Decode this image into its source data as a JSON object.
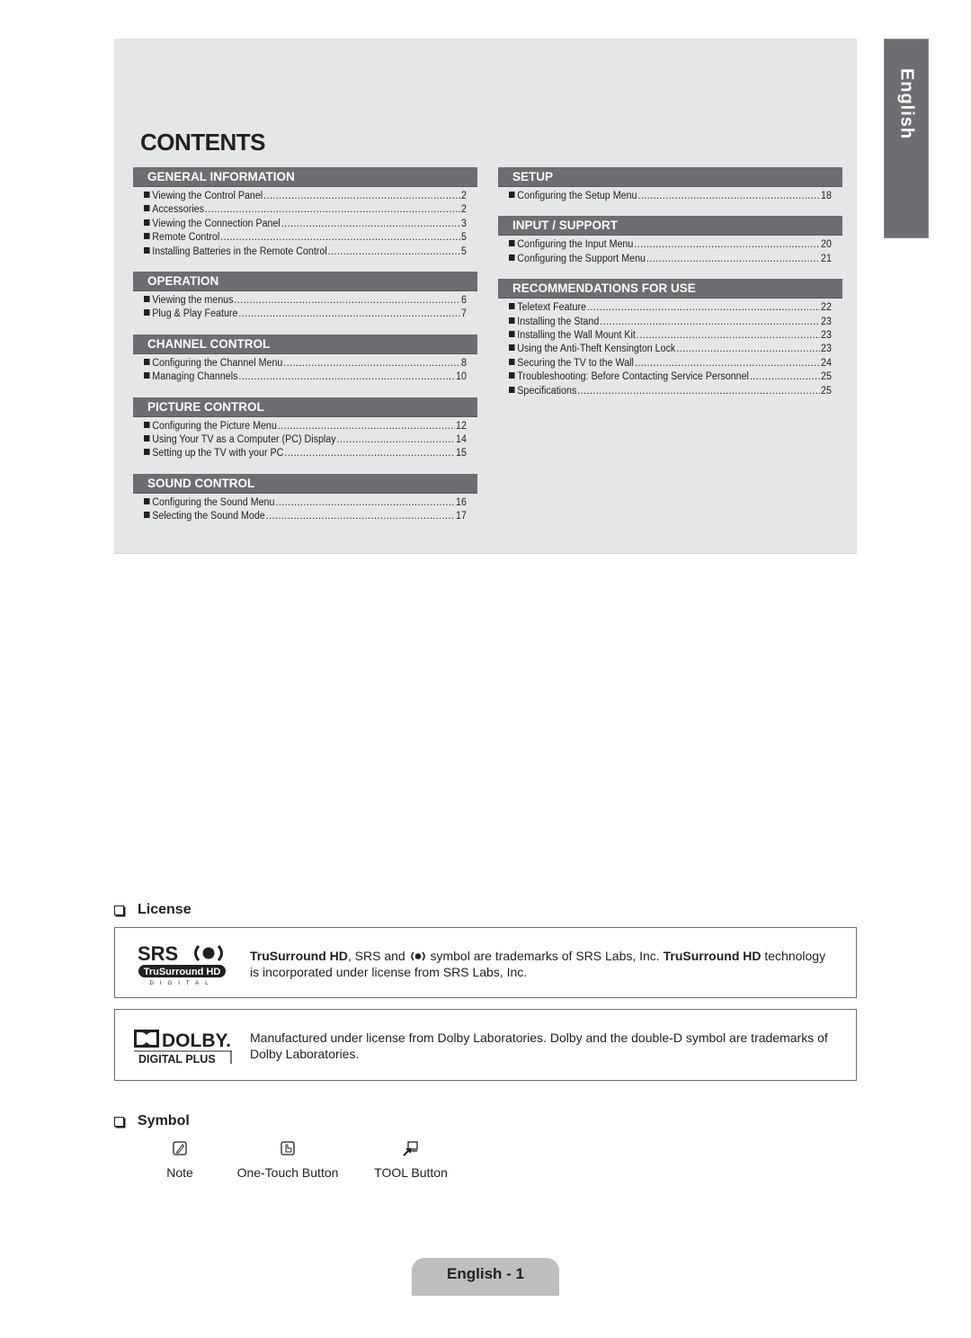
{
  "contents": {
    "title": "CONTENTS",
    "left_sections": [
      {
        "header": "GENERAL INFORMATION",
        "entries": [
          {
            "title": "Viewing the Control Panel",
            "page": "2"
          },
          {
            "title": "Accessories",
            "page": "2"
          },
          {
            "title": "Viewing the Connection Panel",
            "page": "3"
          },
          {
            "title": "Remote Control",
            "page": "5"
          },
          {
            "title": "Installing Batteries in the Remote Control",
            "page": "5"
          }
        ]
      },
      {
        "header": "OPERATION",
        "entries": [
          {
            "title": "Viewing the menus",
            "page": "6"
          },
          {
            "title": "Plug & Play Feature",
            "page": "7"
          }
        ]
      },
      {
        "header": "CHANNEL CONTROL",
        "entries": [
          {
            "title": "Configuring the Channel Menu",
            "page": "8"
          },
          {
            "title": "Managing Channels",
            "page": "10"
          }
        ]
      },
      {
        "header": "PICTURE CONTROL",
        "entries": [
          {
            "title": "Configuring the Picture Menu",
            "page": "12"
          },
          {
            "title": "Using Your TV as a Computer (PC) Display",
            "page": "14"
          },
          {
            "title": "Setting up the TV with your PC",
            "page": "15"
          }
        ]
      },
      {
        "header": "SOUND CONTROL",
        "entries": [
          {
            "title": "Configuring the Sound Menu",
            "page": "16"
          },
          {
            "title": "Selecting the Sound Mode",
            "page": "17"
          }
        ]
      }
    ],
    "right_sections": [
      {
        "header": "SETUP",
        "entries": [
          {
            "title": "Configuring the Setup Menu",
            "page": "18"
          }
        ]
      },
      {
        "header": "INPUT / SUPPORT",
        "entries": [
          {
            "title": "Configuring the Input Menu",
            "page": "20"
          },
          {
            "title": "Configuring the Support Menu",
            "page": "21"
          }
        ]
      },
      {
        "header": "RECOMMENDATIONS FOR USE",
        "entries": [
          {
            "title": "Teletext Feature",
            "page": "22"
          },
          {
            "title": "Installing the Stand",
            "page": "23"
          },
          {
            "title": "Installing the Wall Mount Kit",
            "page": "23"
          },
          {
            "title": "Using the Anti-Theft Kensington Lock",
            "page": "23"
          },
          {
            "title": "Securing the TV to the Wall",
            "page": "24"
          },
          {
            "title": "Troubleshooting: Before Contacting Service Personnel",
            "page": "25"
          },
          {
            "title": "Specifications",
            "page": "25"
          }
        ]
      }
    ]
  },
  "language_tab": "English",
  "license": {
    "heading": "License",
    "srs": {
      "logo_text_top": "SRS",
      "logo_text_mid": "TruSurround HD",
      "logo_text_bottom": "DIGITAL",
      "text_bold_1": "TruSurround HD",
      "text_1": ", SRS and ",
      "text_2": " symbol are trademarks of SRS Labs, Inc. ",
      "text_bold_2": "TruSurround HD",
      "text_3": " technology is incorporated under license from SRS Labs, Inc."
    },
    "dolby": {
      "logo_text_top": "DOLBY.",
      "logo_text_bottom": "DIGITAL PLUS",
      "text": "Manufactured under license from Dolby Laboratories. Dolby and the double-D symbol are trademarks of Dolby Laboratories."
    }
  },
  "symbol": {
    "heading": "Symbol",
    "items": [
      {
        "icon": "note-icon",
        "label": "Note"
      },
      {
        "icon": "one-touch-button-icon",
        "label": "One-Touch Button"
      },
      {
        "icon": "tool-button-icon",
        "label": "TOOL Button"
      }
    ]
  },
  "footer": {
    "page_label": "English - 1"
  }
}
